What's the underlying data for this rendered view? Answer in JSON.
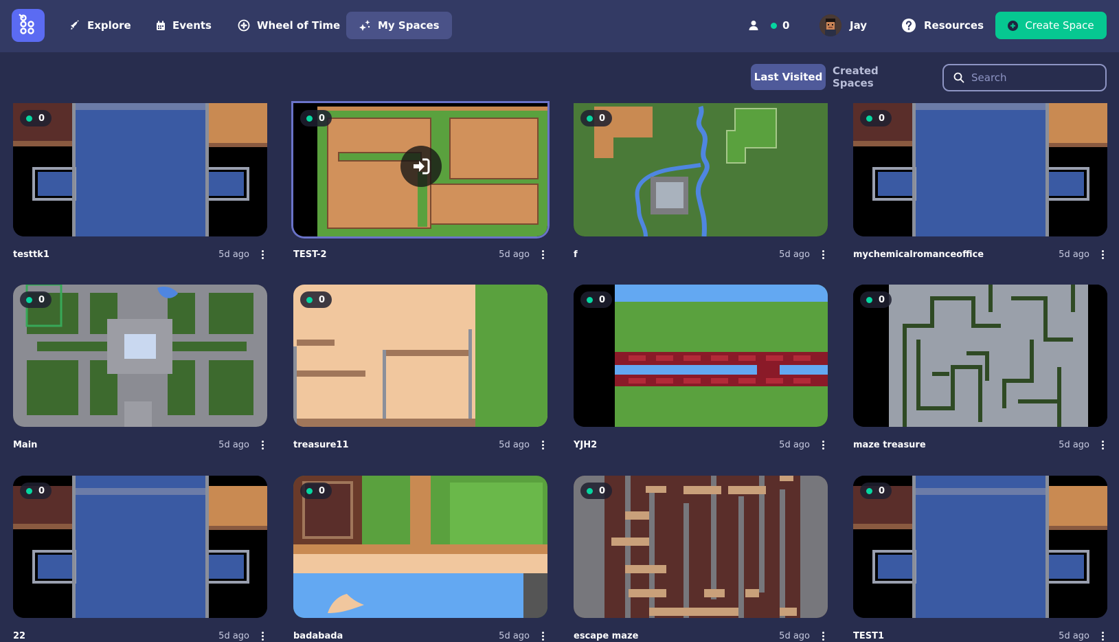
{
  "nav": {
    "items": [
      {
        "label": "Explore",
        "icon": "rocket-icon"
      },
      {
        "label": "Events",
        "icon": "calendar-icon"
      },
      {
        "label": "Wheel of Time",
        "icon": "wheel-icon"
      },
      {
        "label": "My Spaces",
        "icon": "sparkle-icon"
      }
    ],
    "active": "My Spaces",
    "online_count": "0",
    "user_name": "Jay",
    "resources_label": "Resources",
    "create_label": "Create Space"
  },
  "filters": {
    "last_visited": "Last Visited",
    "created_spaces": "Created Spaces",
    "search_placeholder": "Search"
  },
  "colors": {
    "background": "#282d4e",
    "topbar": "#333a64",
    "accent": "#06c891",
    "online": "#06d6a0"
  },
  "spaces": [
    {
      "name": "testtk1",
      "time": "5d ago",
      "online": "0"
    },
    {
      "name": "TEST-2",
      "time": "5d ago",
      "online": "0"
    },
    {
      "name": "f",
      "time": "5d ago",
      "online": "0"
    },
    {
      "name": "mychemicalromanceoffice",
      "time": "5d ago",
      "online": "0"
    },
    {
      "name": "Main",
      "time": "5d ago",
      "online": "0"
    },
    {
      "name": "treasure11",
      "time": "5d ago",
      "online": "0"
    },
    {
      "name": "YJH2",
      "time": "5d ago",
      "online": "0"
    },
    {
      "name": "maze treasure",
      "time": "5d ago",
      "online": "0"
    },
    {
      "name": "22",
      "time": "5d ago",
      "online": "0"
    },
    {
      "name": "badabada",
      "time": "5d ago",
      "online": "0"
    },
    {
      "name": "escape maze",
      "time": "5d ago",
      "online": "0"
    },
    {
      "name": "TEST1",
      "time": "5d ago",
      "online": "0"
    }
  ]
}
